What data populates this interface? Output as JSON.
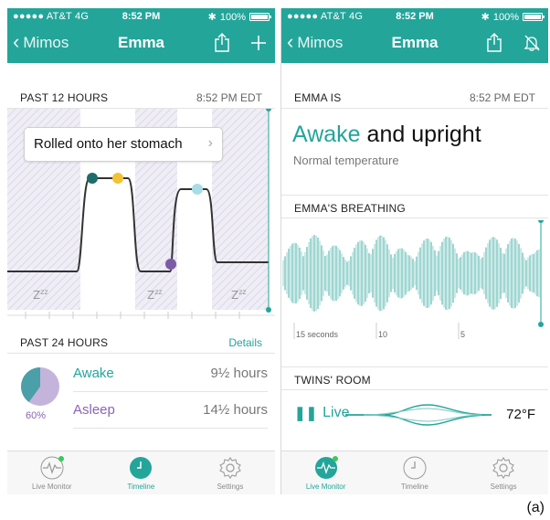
{
  "caption": "(a)",
  "left": {
    "status": {
      "carrier": "●●●●● AT&T  4G",
      "time": "8:52 PM",
      "battery": "100%"
    },
    "nav": {
      "back_label": "Mimos",
      "title": "Emma"
    },
    "past12": {
      "label": "PAST 12 HOURS",
      "time": "8:52 PM EDT"
    },
    "tooltip": "Rolled onto her stomach",
    "sleep_marks": [
      "Z",
      "Z",
      "Z"
    ],
    "past24": {
      "label": "PAST 24 HOURS",
      "details": "Details"
    },
    "pie": {
      "percent_label": "60%",
      "awake_fraction": 0.4,
      "asleep_fraction": 0.6
    },
    "rows": [
      {
        "label": "Awake",
        "value": "9½ hours",
        "color": "#23a59a"
      },
      {
        "label": "Asleep",
        "value": "14½ hours",
        "color": "#8a64b4"
      }
    ],
    "tabs": [
      {
        "label": "Live Monitor",
        "icon": "heartbeat-icon"
      },
      {
        "label": "Timeline",
        "icon": "clock-icon"
      },
      {
        "label": "Settings",
        "icon": "gear-icon"
      }
    ]
  },
  "right": {
    "status": {
      "carrier": "●●●●● AT&T  4G",
      "time": "8:52 PM",
      "battery": "100%"
    },
    "nav": {
      "back_label": "Mimos",
      "title": "Emma"
    },
    "emma_is": {
      "label": "EMMA IS",
      "time": "8:52 PM EDT"
    },
    "state": {
      "highlight": "Awake",
      "rest": " and upright",
      "sub": "Normal temperature"
    },
    "breathing": {
      "label": "EMMA'S BREATHING",
      "ticks": [
        "15 seconds",
        "10",
        "5"
      ]
    },
    "room": {
      "label": "TWINS' ROOM",
      "live": "Live",
      "temp": "72°F"
    },
    "tabs": [
      {
        "label": "Live Monitor",
        "icon": "heartbeat-icon"
      },
      {
        "label": "Timeline",
        "icon": "clock-icon"
      },
      {
        "label": "Settings",
        "icon": "gear-icon"
      }
    ]
  },
  "colors": {
    "accent": "#23a59a",
    "purple": "#8a64b4",
    "yellow": "#f2c233",
    "lightblue": "#a8dce6"
  }
}
